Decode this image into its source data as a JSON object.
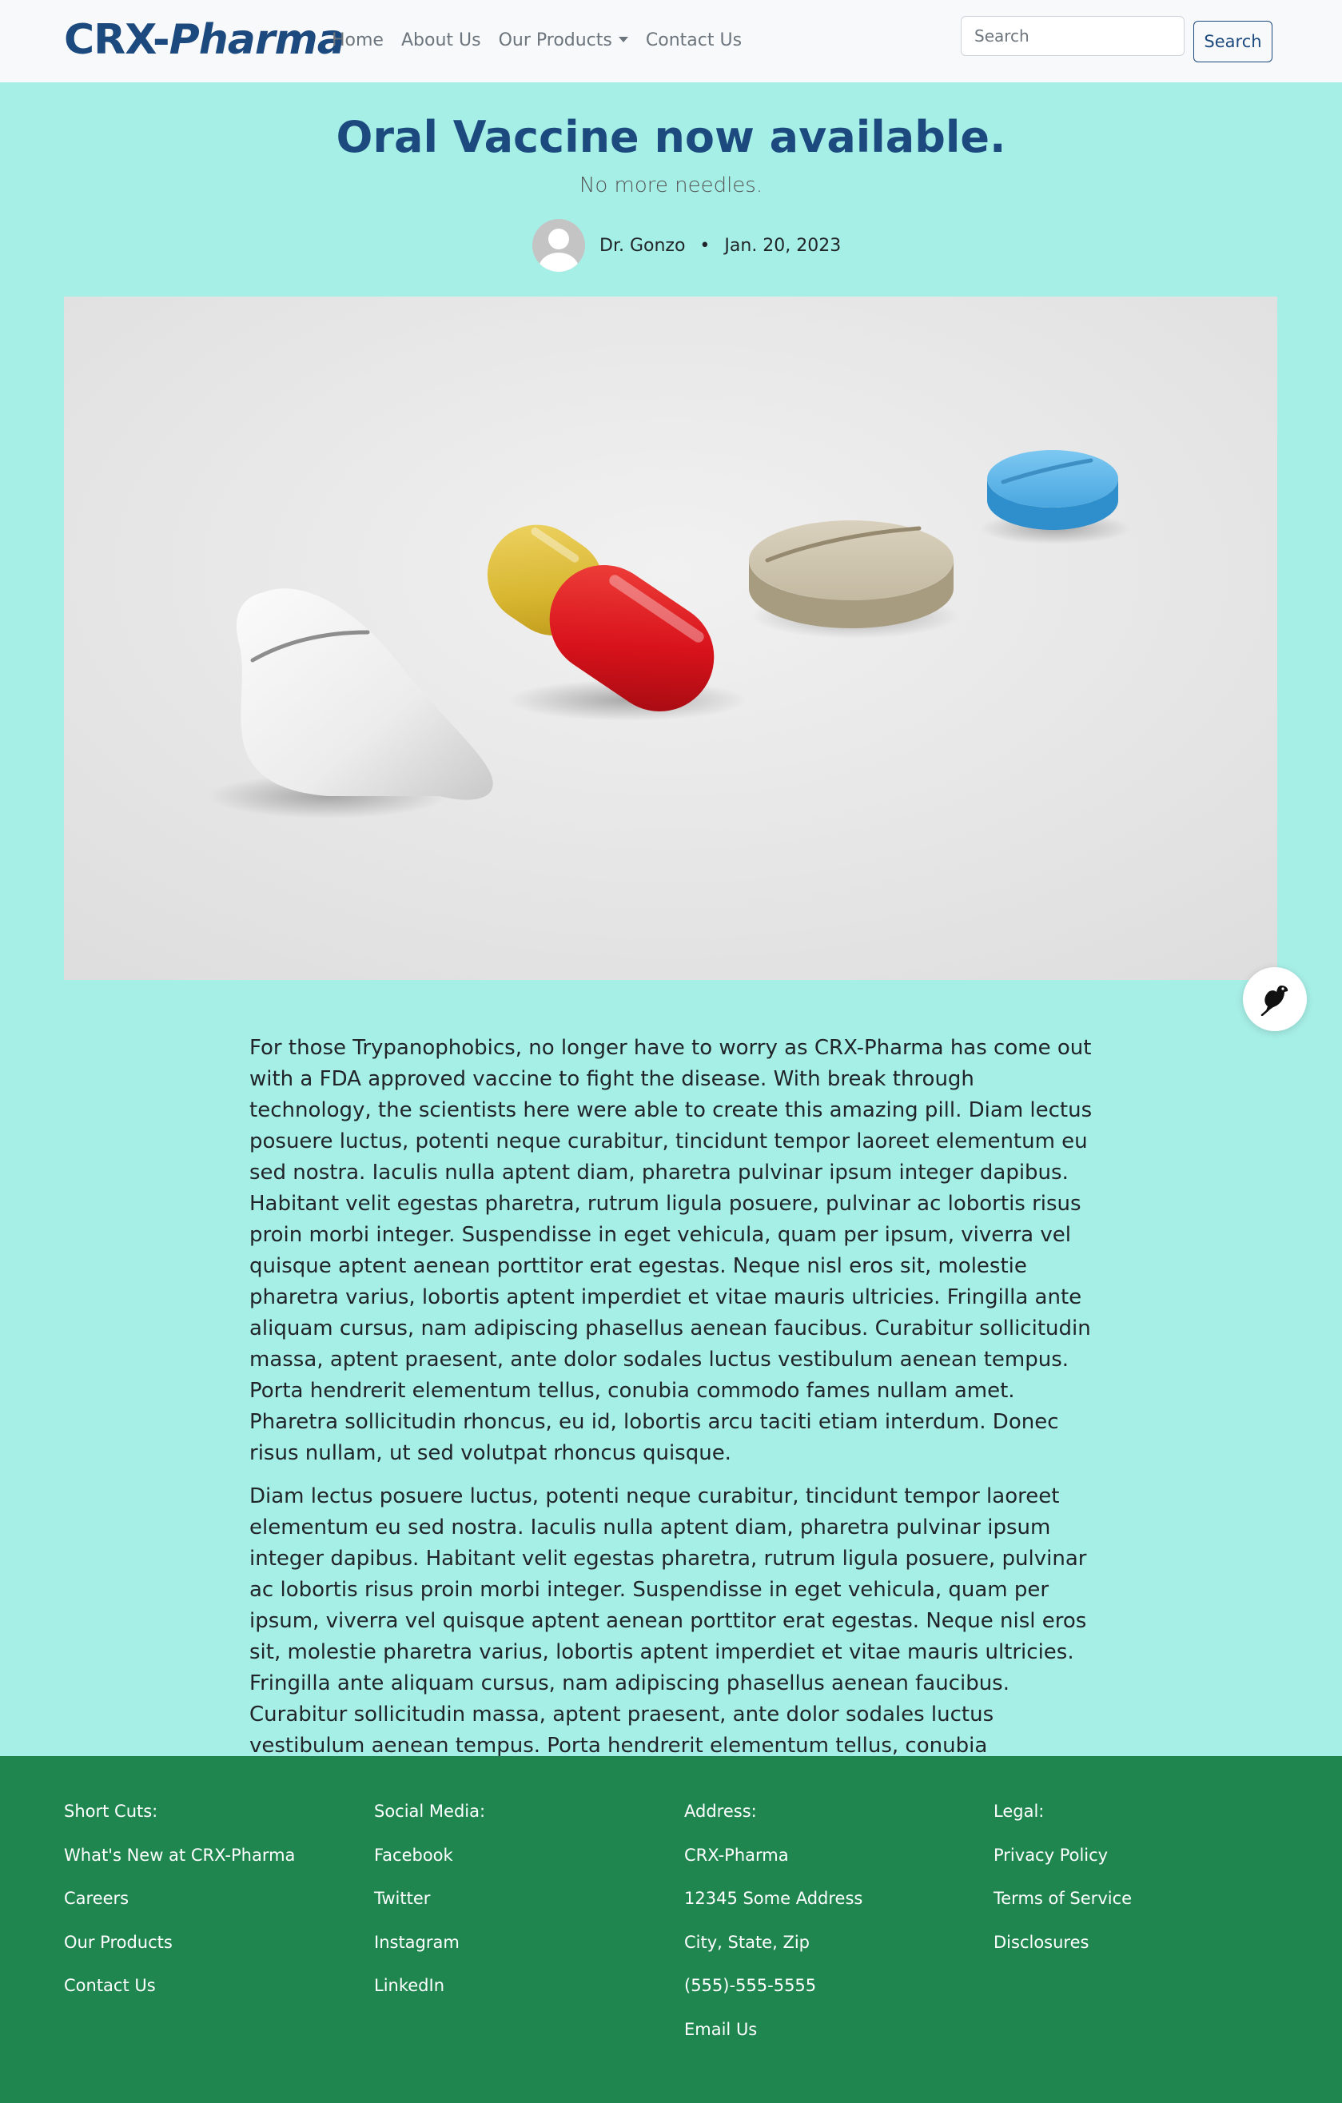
{
  "nav": {
    "brand_part1": "CRX-",
    "brand_part2": "Pharma",
    "links": [
      "Home",
      "About Us",
      "Our Products",
      "Contact Us"
    ],
    "search_placeholder": "Search",
    "search_button": "Search"
  },
  "article": {
    "title": "Oral Vaccine now available.",
    "subtitle": "No more needles.",
    "author": "Dr. Gonzo",
    "separator": "•",
    "date": "Jan. 20, 2023",
    "hero_image": "pills-photo",
    "paragraphs": [
      "For those Trypanophobics, no longer have to worry as CRX-Pharma has come out with a FDA approved vaccine to fight the disease. With break through technology, the scientists here were able to create this amazing pill. Diam lectus posuere luctus, potenti neque curabitur, tincidunt tempor laoreet elementum eu sed nostra. Iaculis nulla aptent diam, pharetra pulvinar ipsum integer dapibus. Habitant velit egestas pharetra, rutrum ligula posuere, pulvinar ac lobortis risus proin morbi integer. Suspendisse in eget vehicula, quam per ipsum, viverra vel quisque aptent aenean porttitor erat egestas. Neque nisl eros sit, molestie pharetra varius, lobortis aptent imperdiet et vitae mauris ultricies. Fringilla ante aliquam cursus, nam adipiscing phasellus aenean faucibus. Curabitur sollicitudin massa, aptent praesent, ante dolor sodales luctus vestibulum aenean tempus. Porta hendrerit elementum tellus, conubia commodo fames nullam amet. Pharetra sollicitudin rhoncus, eu id, lobortis arcu taciti etiam interdum. Donec risus nullam, ut sed volutpat rhoncus quisque.",
      "Diam lectus posuere luctus, potenti neque curabitur, tincidunt tempor laoreet elementum eu sed nostra. Iaculis nulla aptent diam, pharetra pulvinar ipsum integer dapibus. Habitant velit egestas pharetra, rutrum ligula posuere, pulvinar ac lobortis risus proin morbi integer. Suspendisse in eget vehicula, quam per ipsum, viverra vel quisque aptent aenean porttitor erat egestas. Neque nisl eros sit, molestie pharetra varius, lobortis aptent imperdiet et vitae mauris ultricies. Fringilla ante aliquam cursus, nam adipiscing phasellus aenean faucibus. Curabitur sollicitudin massa, aptent praesent, ante dolor sodales luctus vestibulum aenean tempus. Porta hendrerit elementum tellus, conubia commodo fames nullam amet. Pharetra sollicitudin rhoncus, eu id, lobortis arcu taciti etiam interdum. Donec risus nullam, ut sed volutpat rhoncus quisque."
    ]
  },
  "fab_icon": "bird-icon",
  "footer": {
    "shortcuts": {
      "heading": "Short Cuts:",
      "items": [
        "What's New at CRX-Pharma",
        "Careers",
        "Our Products",
        "Contact Us"
      ]
    },
    "social": {
      "heading": "Social Media:",
      "items": [
        "Facebook",
        "Twitter",
        "Instagram",
        "LinkedIn"
      ]
    },
    "address": {
      "heading": "Address:",
      "items": [
        "CRX-Pharma",
        "12345 Some Address",
        "City, State, Zip",
        "(555)-555-5555",
        "Email Us"
      ]
    },
    "legal": {
      "heading": "Legal:",
      "items": [
        "Privacy Policy",
        "Terms of Service",
        "Disclosures"
      ]
    }
  },
  "colors": {
    "page_bg": "#a6efe7",
    "brand": "#1c4a7e",
    "footer_bg": "#1f8650"
  }
}
